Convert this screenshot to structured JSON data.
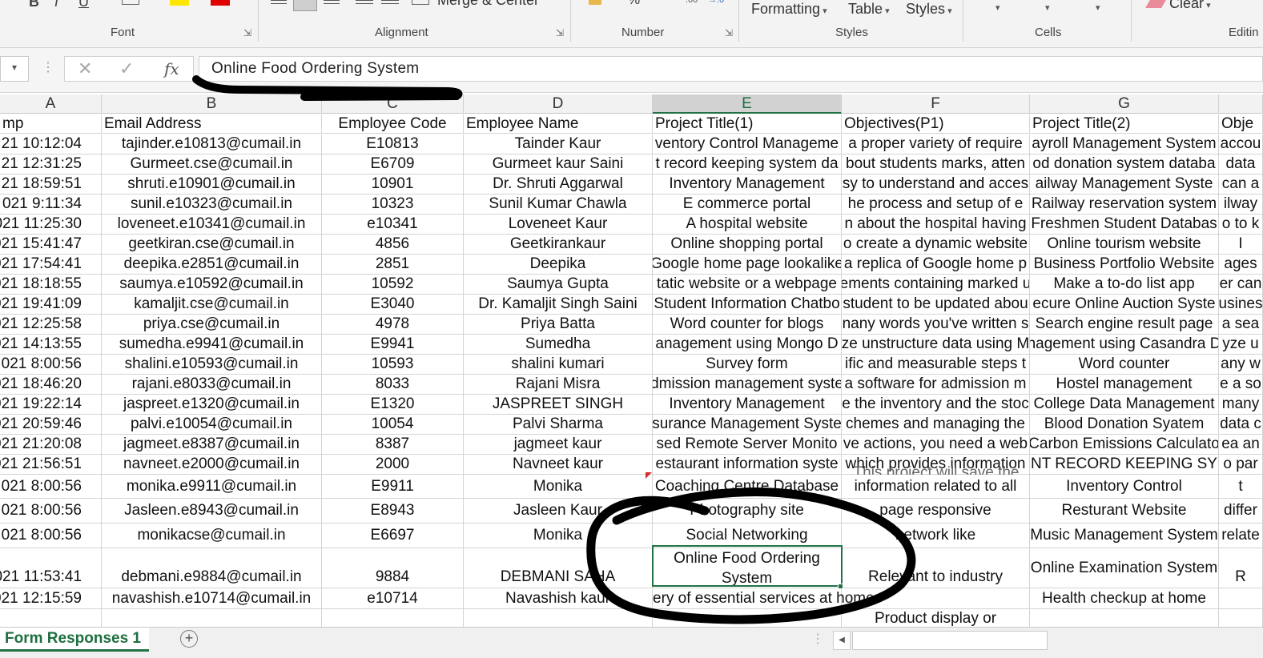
{
  "ribbon": {
    "groups": [
      {
        "label": "Font"
      },
      {
        "label": "Alignment"
      },
      {
        "label": "Number"
      },
      {
        "label": "Styles"
      },
      {
        "label": "Cells"
      },
      {
        "label": "Editin"
      }
    ],
    "merge_center": "Merge & Center",
    "number_format": "%",
    "formatting": "Formatting",
    "table": "Table",
    "styles": "Styles",
    "clear": "Clear",
    "font_color": "#e00000",
    "highlight_color": "#ffe600"
  },
  "formula_bar": {
    "fx": "fx",
    "value": "Online Food Ordering System"
  },
  "columns": [
    "A",
    "B",
    "C",
    "D",
    "E",
    "F",
    "G"
  ],
  "selected_column": "E",
  "header_row": [
    "mp",
    "Email Address",
    "Employee Code",
    "Employee Name",
    "Project Title(1)",
    "Objectives(P1)",
    "Project Title(2)",
    "Obje"
  ],
  "rows": [
    [
      "21 10:12:04",
      "tajinder.e10813@cumail.in",
      "E10813",
      "Tainder Kaur",
      "ventory Control Manageme",
      "a proper variety of require",
      "ayroll Management System",
      "accou"
    ],
    [
      "21 12:31:25",
      "Gurmeet.cse@cumail.in",
      "E6709",
      "Gurmeet kaur Saini",
      "t record keeping system da",
      "bout students marks, atten",
      "od donation system databa",
      "data "
    ],
    [
      "21 18:59:51",
      "shruti.e10901@cumail.in",
      "10901",
      "Dr. Shruti Aggarwal",
      "Inventory Management",
      "sy to understand and acces",
      "ailway Management Syste",
      "can a"
    ],
    [
      "021 9:11:34",
      "sunil.e10323@cumail.in",
      "10323",
      "Sunil Kumar Chawla",
      "E commerce portal",
      "he process and setup of e",
      "Railway reservation system",
      "ilway"
    ],
    [
      "021 11:25:30",
      "loveneet.e10341@cumail.in",
      "e10341",
      "Loveneet Kaur",
      "A hospital website",
      "n about the hospital having",
      "Freshmen Student Databas",
      "o to k"
    ],
    [
      "021 15:41:47",
      "geetkiran.cse@cumail.in",
      "4856",
      "Geetkirankaur",
      "Online shopping portal",
      "o create a dynamic website",
      "Online tourism website",
      "I"
    ],
    [
      "021 17:54:41",
      "deepika.e2851@cumail.in",
      "2851",
      "Deepika",
      "Google home page lookalike",
      "a replica of Google home p",
      "Business Portfolio Website",
      "ages "
    ],
    [
      "021 18:18:55",
      "saumya.e10592@cumail.in",
      "10592",
      "Saumya Gupta",
      "tatic website or a webpage",
      "ements containing marked u",
      "Make a to-do list app",
      "er can"
    ],
    [
      "021 19:41:09",
      "kamaljit.cse@cumail.in",
      "E3040",
      "Dr. Kamaljit Singh Saini",
      "Student Information Chatbo",
      "student to be updated abou",
      "ecure Online Auction Syste",
      "usines"
    ],
    [
      "021 12:25:58",
      "priya.cse@cumail.in",
      "4978",
      "Priya Batta",
      "Word counter for blogs",
      "nany words you've written s",
      "Search engine result page",
      "a sea"
    ],
    [
      "021 14:13:55",
      "sumedha.e9941@cumail.in",
      "E9941",
      "Sumedha",
      "anagement using  Mongo D",
      "ze unstructure data using M",
      "nagement using Casandra D",
      "yze u"
    ],
    [
      "021 8:00:56",
      "shalini.e10593@cumail.in",
      "10593",
      "shalini kumari",
      "Survey form",
      "ific and measurable steps t",
      "Word counter",
      "any w"
    ],
    [
      "021 18:46:20",
      "rajani.e8033@cumail.in",
      "8033",
      "Rajani Misra",
      "dmission management syste",
      "a software for admission m",
      "Hostel management",
      "e a so"
    ],
    [
      "021 19:22:14",
      "jaspreet.e1320@cumail.in",
      "E1320",
      "JASPREET SINGH",
      "Inventory Management",
      "e the inventory and the stoc",
      "College Data Management",
      "many"
    ],
    [
      "021 20:59:46",
      "palvi.e10054@cumail.in",
      "10054",
      "Palvi Sharma",
      "surance Management Syste",
      "chemes and managing the",
      "Blood Donation Syatem",
      "data c"
    ],
    [
      "021 21:20:08",
      "jagmeet.e8387@cumail.in",
      "8387",
      "jagmeet kaur",
      "sed Remote Server Monito",
      "ve actions, you need a web",
      "Carbon Emissions Calculato",
      "ea an"
    ],
    [
      "021 21:56:51",
      "navneet.e2000@cumail.in",
      "2000",
      "Navneet kaur",
      "estaurant information syste",
      "which provides information",
      "NT RECORD KEEPING SY",
      "o par"
    ],
    [
      "021 8:00:56",
      "monika.e9911@cumail.in",
      "E9911",
      "Monika",
      "Coaching Centre Database",
      "information related to all",
      "Inventory Control",
      "t"
    ],
    [
      "021 8:00:56",
      "Jasleen.e8943@cumail.in",
      "E8943",
      "Jasleen Kaur",
      "Photography site",
      "page responsive",
      "Resturant Website",
      "differ"
    ],
    [
      "021 8:00:56",
      "monikacse@cumail.in",
      "E6697",
      "Monika",
      "Social Networking",
      "network like",
      "Music Management System",
      "relate"
    ],
    [
      "021 11:53:41",
      "debmani.e9884@cumail.in",
      "9884",
      "DEBMANI SAHA",
      "Online Food Ordering System",
      "Relevant to industry",
      "Online Examination System",
      "R"
    ],
    [
      "021 12:15:59",
      "navashish.e10714@cumail.in",
      "e10714",
      "Navashish kaur",
      "ery of essential services at home",
      "",
      "Health checkup at home",
      ""
    ],
    [
      "",
      "",
      "",
      "",
      "",
      "Product display or",
      "",
      ""
    ]
  ],
  "overflow_text_f17": "This project will save the",
  "sheet_tab": "Form Responses 1",
  "add_sheet": "+"
}
